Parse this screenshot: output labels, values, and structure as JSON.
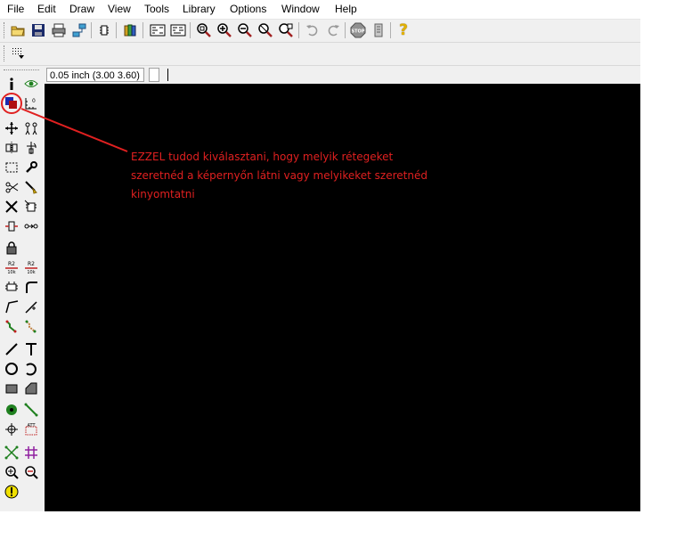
{
  "menu": [
    "File",
    "Edit",
    "Draw",
    "View",
    "Tools",
    "Library",
    "Options",
    "Window",
    "Help"
  ],
  "coordinates": {
    "grid_display": "0.05 inch (3.00 3.60)"
  },
  "annotation": {
    "line1": "EZZEL tudod kiválasztani, hogy melyik rétegeket",
    "line2": "szeretnéd a képernyőn látni vagy melyikeket szeretnéd",
    "line3": "kinyomtatni"
  },
  "left_toolbar": {
    "resistor_label_a": "R2",
    "resistor_value_a": "10k",
    "resistor_label_b": "R2",
    "resistor_value_b": "10k"
  },
  "toolbar": {
    "stop_label": "STOP",
    "help_label": "?"
  },
  "colors": {
    "canvas": "#000000",
    "annotation": "#e02020",
    "highlight_circle": "#e02020"
  }
}
